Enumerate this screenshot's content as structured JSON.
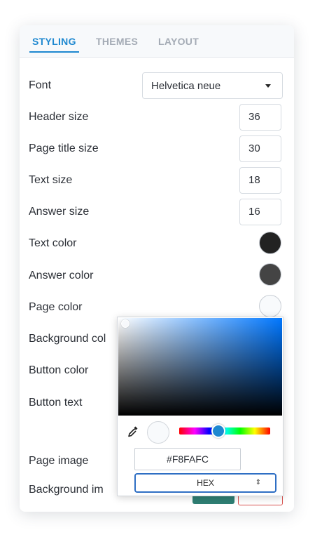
{
  "tabs": [
    "STYLING",
    "THEMES",
    "LAYOUT"
  ],
  "active_tab": "STYLING",
  "rows": {
    "font": {
      "label": "Font",
      "value": "Helvetica neue"
    },
    "header_size": {
      "label": "Header size",
      "value": "36"
    },
    "page_title_size": {
      "label": "Page title size",
      "value": "30"
    },
    "text_size": {
      "label": "Text size",
      "value": "18"
    },
    "answer_size": {
      "label": "Answer size",
      "value": "16"
    },
    "text_color": {
      "label": "Text color",
      "color": "#222222"
    },
    "answer_color": {
      "label": "Answer color",
      "color": "#444444"
    },
    "page_color": {
      "label": "Page color",
      "color": "#F8FAFC"
    },
    "background_color": {
      "label": "Background col"
    },
    "button_color": {
      "label": "Button color"
    },
    "button_text": {
      "label": "Button text"
    },
    "page_image": {
      "label": "Page image"
    },
    "background_image": {
      "label": "Background im"
    }
  },
  "picker": {
    "hex_value": "#F8FAFC",
    "mode": "HEX",
    "mode_icon": "up-down-arrows-icon",
    "eyedropper_icon": "eyedropper-icon"
  },
  "colors": {
    "accent": "#1e88d0",
    "upload_button": "#2f7f74",
    "delete_button_border": "#d9534f"
  }
}
